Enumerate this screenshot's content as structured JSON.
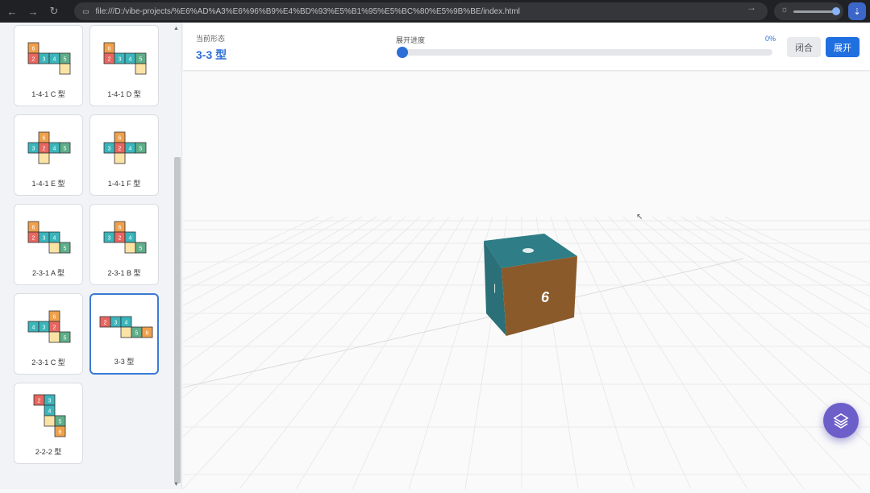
{
  "browser": {
    "url": "file:///D:/vibe-projects/%E6%AD%A3%E6%96%B9%E4%BD%93%E5%B1%95%E5%BC%80%E5%9B%BE/index.html"
  },
  "nets": [
    {
      "label": "1-4-1 C 型",
      "cells": [
        [
          0,
          0,
          "6",
          "#f0a04b"
        ],
        [
          0,
          1,
          "2",
          "#e8665f"
        ],
        [
          1,
          1,
          "3",
          "#3ab5bb"
        ],
        [
          2,
          1,
          "4",
          "#3ab5bb"
        ],
        [
          3,
          1,
          "5",
          "#5fae8a"
        ],
        [
          3,
          2,
          "",
          "#fbe3a6"
        ]
      ]
    },
    {
      "label": "1-4-1 D 型",
      "cells": [
        [
          0,
          0,
          "6",
          "#f0a04b"
        ],
        [
          0,
          1,
          "2",
          "#e8665f"
        ],
        [
          1,
          1,
          "3",
          "#3ab5bb"
        ],
        [
          2,
          1,
          "4",
          "#3ab5bb"
        ],
        [
          3,
          1,
          "5",
          "#5fae8a"
        ],
        [
          3,
          2,
          "",
          "#fbe3a6"
        ]
      ]
    },
    {
      "label": "1-4-1 E 型",
      "cells": [
        [
          1,
          0,
          "6",
          "#f0a04b"
        ],
        [
          0,
          1,
          "3",
          "#3ab5bb"
        ],
        [
          1,
          1,
          "2",
          "#e8665f"
        ],
        [
          2,
          1,
          "4",
          "#3ab5bb"
        ],
        [
          3,
          1,
          "5",
          "#5fae8a"
        ],
        [
          1,
          2,
          "",
          "#fbe3a6"
        ]
      ]
    },
    {
      "label": "1-4-1 F 型",
      "cells": [
        [
          1,
          0,
          "6",
          "#f0a04b"
        ],
        [
          0,
          1,
          "3",
          "#3ab5bb"
        ],
        [
          1,
          1,
          "2",
          "#e8665f"
        ],
        [
          2,
          1,
          "4",
          "#3ab5bb"
        ],
        [
          3,
          1,
          "5",
          "#5fae8a"
        ],
        [
          1,
          2,
          "",
          "#fbe3a6"
        ]
      ]
    },
    {
      "label": "2-3-1 A 型",
      "cells": [
        [
          0,
          0,
          "6",
          "#f0a04b"
        ],
        [
          0,
          1,
          "2",
          "#e8665f"
        ],
        [
          1,
          1,
          "3",
          "#3ab5bb"
        ],
        [
          2,
          1,
          "4",
          "#3ab5bb"
        ],
        [
          2,
          2,
          "",
          "#fbe3a6"
        ],
        [
          3,
          2,
          "5",
          "#5fae8a"
        ]
      ]
    },
    {
      "label": "2-3-1 B 型",
      "cells": [
        [
          1,
          0,
          "6",
          "#f0a04b"
        ],
        [
          0,
          1,
          "3",
          "#3ab5bb"
        ],
        [
          1,
          1,
          "2",
          "#e8665f"
        ],
        [
          2,
          1,
          "4",
          "#3ab5bb"
        ],
        [
          2,
          2,
          "",
          "#fbe3a6"
        ],
        [
          3,
          2,
          "5",
          "#5fae8a"
        ]
      ]
    },
    {
      "label": "2-3-1 C 型",
      "cells": [
        [
          2,
          0,
          "6",
          "#f0a04b"
        ],
        [
          0,
          1,
          "4",
          "#3ab5bb"
        ],
        [
          1,
          1,
          "3",
          "#3ab5bb"
        ],
        [
          2,
          1,
          "2",
          "#e8665f"
        ],
        [
          2,
          2,
          "",
          "#fbe3a6"
        ],
        [
          3,
          2,
          "5",
          "#5fae8a"
        ]
      ]
    },
    {
      "label": "3-3 型",
      "cells": [
        [
          0,
          0,
          "2",
          "#e8665f"
        ],
        [
          1,
          0,
          "3",
          "#3ab5bb"
        ],
        [
          2,
          0,
          "4",
          "#3ab5bb"
        ],
        [
          2,
          1,
          "",
          "#fbe3a6"
        ],
        [
          3,
          1,
          "5",
          "#5fae8a"
        ],
        [
          4,
          1,
          "6",
          "#f0a04b"
        ]
      ]
    },
    {
      "label": "2-2-2 型",
      "cells": [
        [
          0,
          0,
          "2",
          "#e8665f"
        ],
        [
          1,
          0,
          "3",
          "#3ab5bb"
        ],
        [
          1,
          1,
          "4",
          "#3ab5bb"
        ],
        [
          1,
          2,
          "",
          "#fbe3a6"
        ],
        [
          2,
          2,
          "5",
          "#5fae8a"
        ],
        [
          2,
          3,
          "6",
          "#f0a04b"
        ]
      ]
    }
  ],
  "selected_net": "3-3 型",
  "topbar": {
    "current_label": "当前形态",
    "current_value": "3-3 型",
    "progress_label": "展开进度",
    "progress_value": "0%",
    "progress": 0,
    "fold_button": "闭合",
    "unfold_button": "展开"
  },
  "cube": {
    "front_label": "6",
    "colors": {
      "front": "#8a5a2b",
      "top": "#2e7d87",
      "side": "#2b6f78"
    }
  },
  "fab": {
    "icon": "layers-icon"
  }
}
